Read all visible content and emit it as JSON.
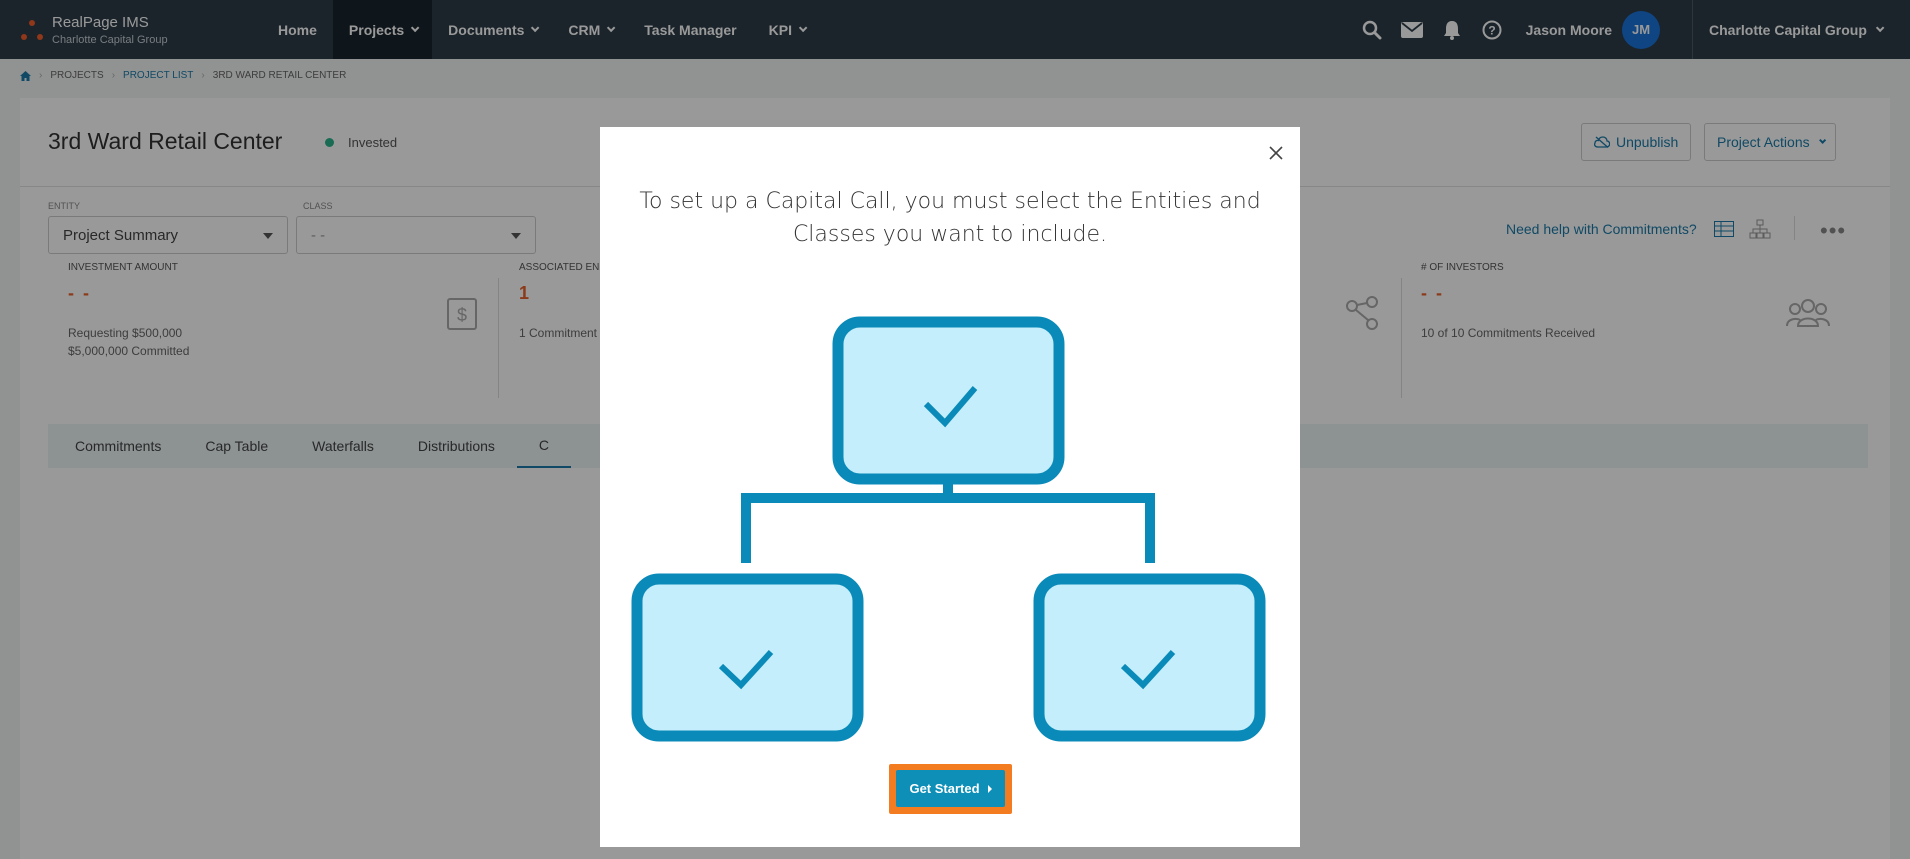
{
  "brand": {
    "title": "RealPage IMS",
    "subtitle": "Charlotte Capital Group"
  },
  "nav": {
    "items": [
      {
        "label": "Home"
      },
      {
        "label": "Projects"
      },
      {
        "label": "Documents"
      },
      {
        "label": "CRM"
      },
      {
        "label": "Task Manager"
      },
      {
        "label": "KPI"
      }
    ],
    "user_name": "Jason Moore",
    "avatar_initials": "JM",
    "org_switch": "Charlotte Capital Group"
  },
  "breadcrumb": {
    "projects": "PROJECTS",
    "project_list": "PROJECT LIST",
    "current": "3RD WARD RETAIL CENTER"
  },
  "project": {
    "title": "3rd Ward Retail Center",
    "status": "Invested",
    "unpublish_label": "Unpublish",
    "actions_label": "Project Actions"
  },
  "filters": {
    "entity_label": "ENTITY",
    "entity_value": "Project Summary",
    "class_label": "CLASS",
    "class_value": "- -",
    "help_link": "Need help with Commitments?"
  },
  "kpis": {
    "investment_label": "INVESTMENT AMOUNT",
    "investment_value": "- -",
    "investment_sub1": "Requesting $500,000",
    "investment_sub2": "$5,000,000 Committed",
    "associated_label": "ASSOCIATED EN",
    "associated_value": "1",
    "associated_sub": "1 Commitment",
    "investors_label": "# OF INVESTORS",
    "investors_value": "- -",
    "investors_sub": "10 of 10 Commitments Received"
  },
  "tabs": [
    {
      "label": "Commitments"
    },
    {
      "label": "Cap Table"
    },
    {
      "label": "Waterfalls"
    },
    {
      "label": "Distributions"
    },
    {
      "label": "C"
    }
  ],
  "modal": {
    "message": "To set up a Capital Call, you must select the Entities and Classes you want to include.",
    "button_label": "Get Started"
  },
  "colors": {
    "nav_bg": "#2d3d48",
    "accent": "#0d8fb8",
    "highlight": "#f47c20",
    "illustration_fill": "#c4eefb",
    "illustration_stroke": "#0a8ab8"
  }
}
